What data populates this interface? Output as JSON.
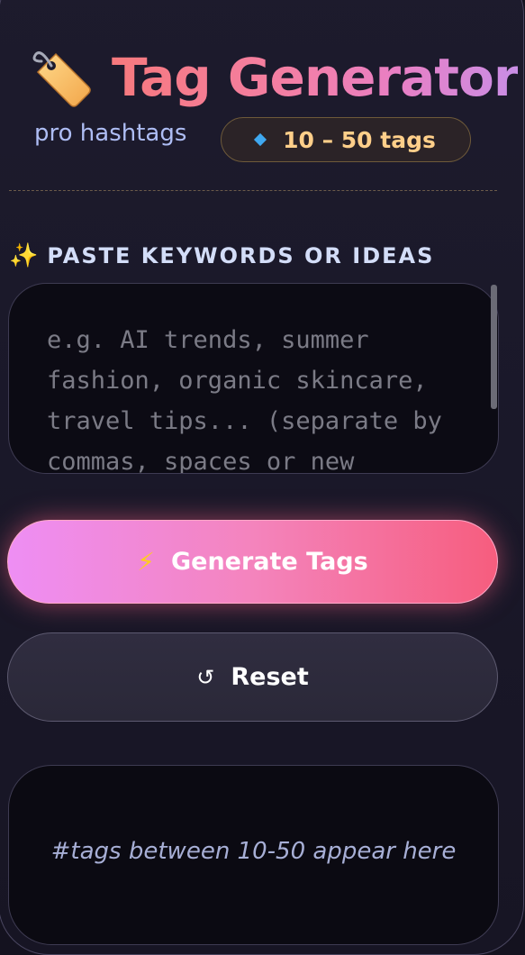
{
  "header": {
    "title": "Tag Generator",
    "subtitle": "pro hashtags",
    "badge_text": "10 – 50 tags",
    "icon": "price-tag-icon",
    "badge_icon": "diamond-icon"
  },
  "input_section": {
    "label": "PASTE KEYWORDS OR IDEAS",
    "label_icon": "sparkles-icon",
    "placeholder": "e.g. AI trends, summer fashion, organic skincare, travel tips... (separate by commas, spaces or new lines)",
    "value": ""
  },
  "actions": {
    "generate_label": "Generate Tags",
    "generate_icon": "lightning-bolt-icon",
    "reset_label": "Reset",
    "reset_icon": "refresh-icon"
  },
  "output": {
    "placeholder": "#tags between 10-50 appear here"
  },
  "colors": {
    "background": "#14121f",
    "title_gradient_start": "#f7797d",
    "title_gradient_end": "#c98ee6",
    "subtitle": "#aebdf4",
    "badge_text": "#ffcf8a",
    "generate_gradient_start": "#ee8ef4",
    "generate_gradient_end": "#f65d7e",
    "output_placeholder": "#a7afd6"
  }
}
